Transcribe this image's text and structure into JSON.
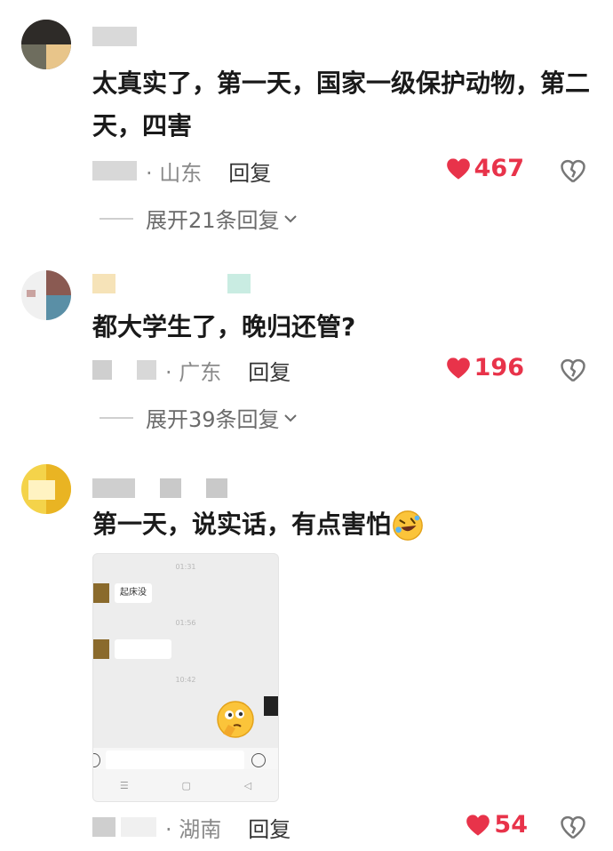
{
  "comments": [
    {
      "text": "太真实了，第一天，国家一级保护动物，第二天，四害",
      "region": "· 山东",
      "reply": "回复",
      "likes": "467",
      "expand": "展开21条回复"
    },
    {
      "text": "都大学生了，晚归还管?",
      "region": "· 广东",
      "reply": "回复",
      "likes": "196",
      "expand": "展开39条回复"
    },
    {
      "text": "第一天，说实话，有点害怕",
      "region": "· 湖南",
      "reply": "回复",
      "likes": "54",
      "expand": ""
    }
  ],
  "screenshot": {
    "bubble1": "起床没",
    "times": [
      "01:31",
      "01:56",
      "10:42"
    ]
  },
  "icons": {
    "like": "heart-icon",
    "dislike": "broken-heart-icon",
    "expand": "chevron-down-icon",
    "laugh_cry": "rolling-laughing-emoji",
    "thinking": "thinking-emoji"
  },
  "colors": {
    "like_red": "#e8334a",
    "meta_gray": "#8a8a8a"
  }
}
